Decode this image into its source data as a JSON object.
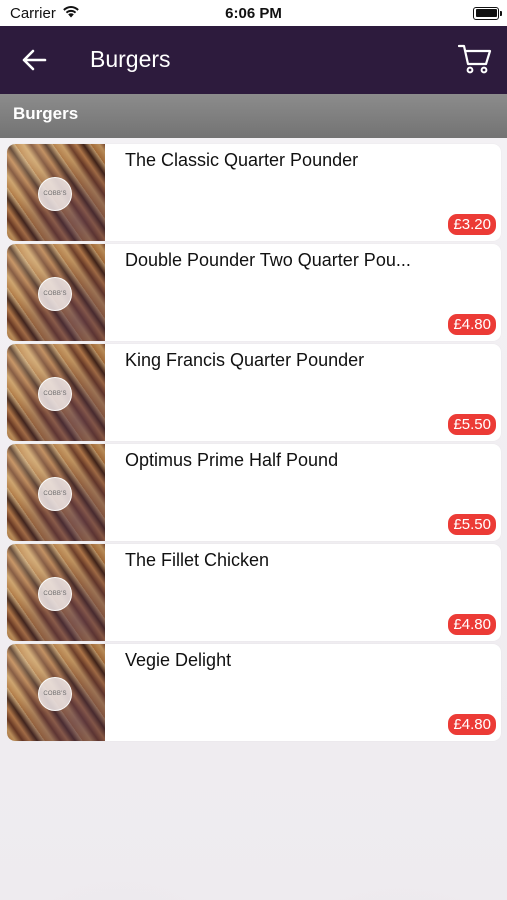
{
  "status_bar": {
    "carrier": "Carrier",
    "time": "6:06 PM"
  },
  "nav": {
    "title": "Burgers",
    "back_icon": "arrow-left-icon",
    "cart_icon": "cart-icon"
  },
  "section": {
    "title": "Burgers"
  },
  "items": [
    {
      "name": "The Classic Quarter Pounder",
      "price": "£3.20",
      "logo": "COBB'S"
    },
    {
      "name": "Double Pounder Two Quarter Pou...",
      "price": "£4.80",
      "logo": "COBB'S"
    },
    {
      "name": "King Francis Quarter Pounder",
      "price": "£5.50",
      "logo": "COBB'S"
    },
    {
      "name": "Optimus Prime Half Pound",
      "price": "£5.50",
      "logo": "COBB'S"
    },
    {
      "name": "The Fillet Chicken",
      "price": "£4.80",
      "logo": "COBB'S"
    },
    {
      "name": "Vegie Delight",
      "price": "£4.80",
      "logo": "COBB'S"
    }
  ],
  "colors": {
    "nav_bg": "#2d1b3d",
    "section_bg": "#808080",
    "price_badge": "#ec3b36"
  }
}
